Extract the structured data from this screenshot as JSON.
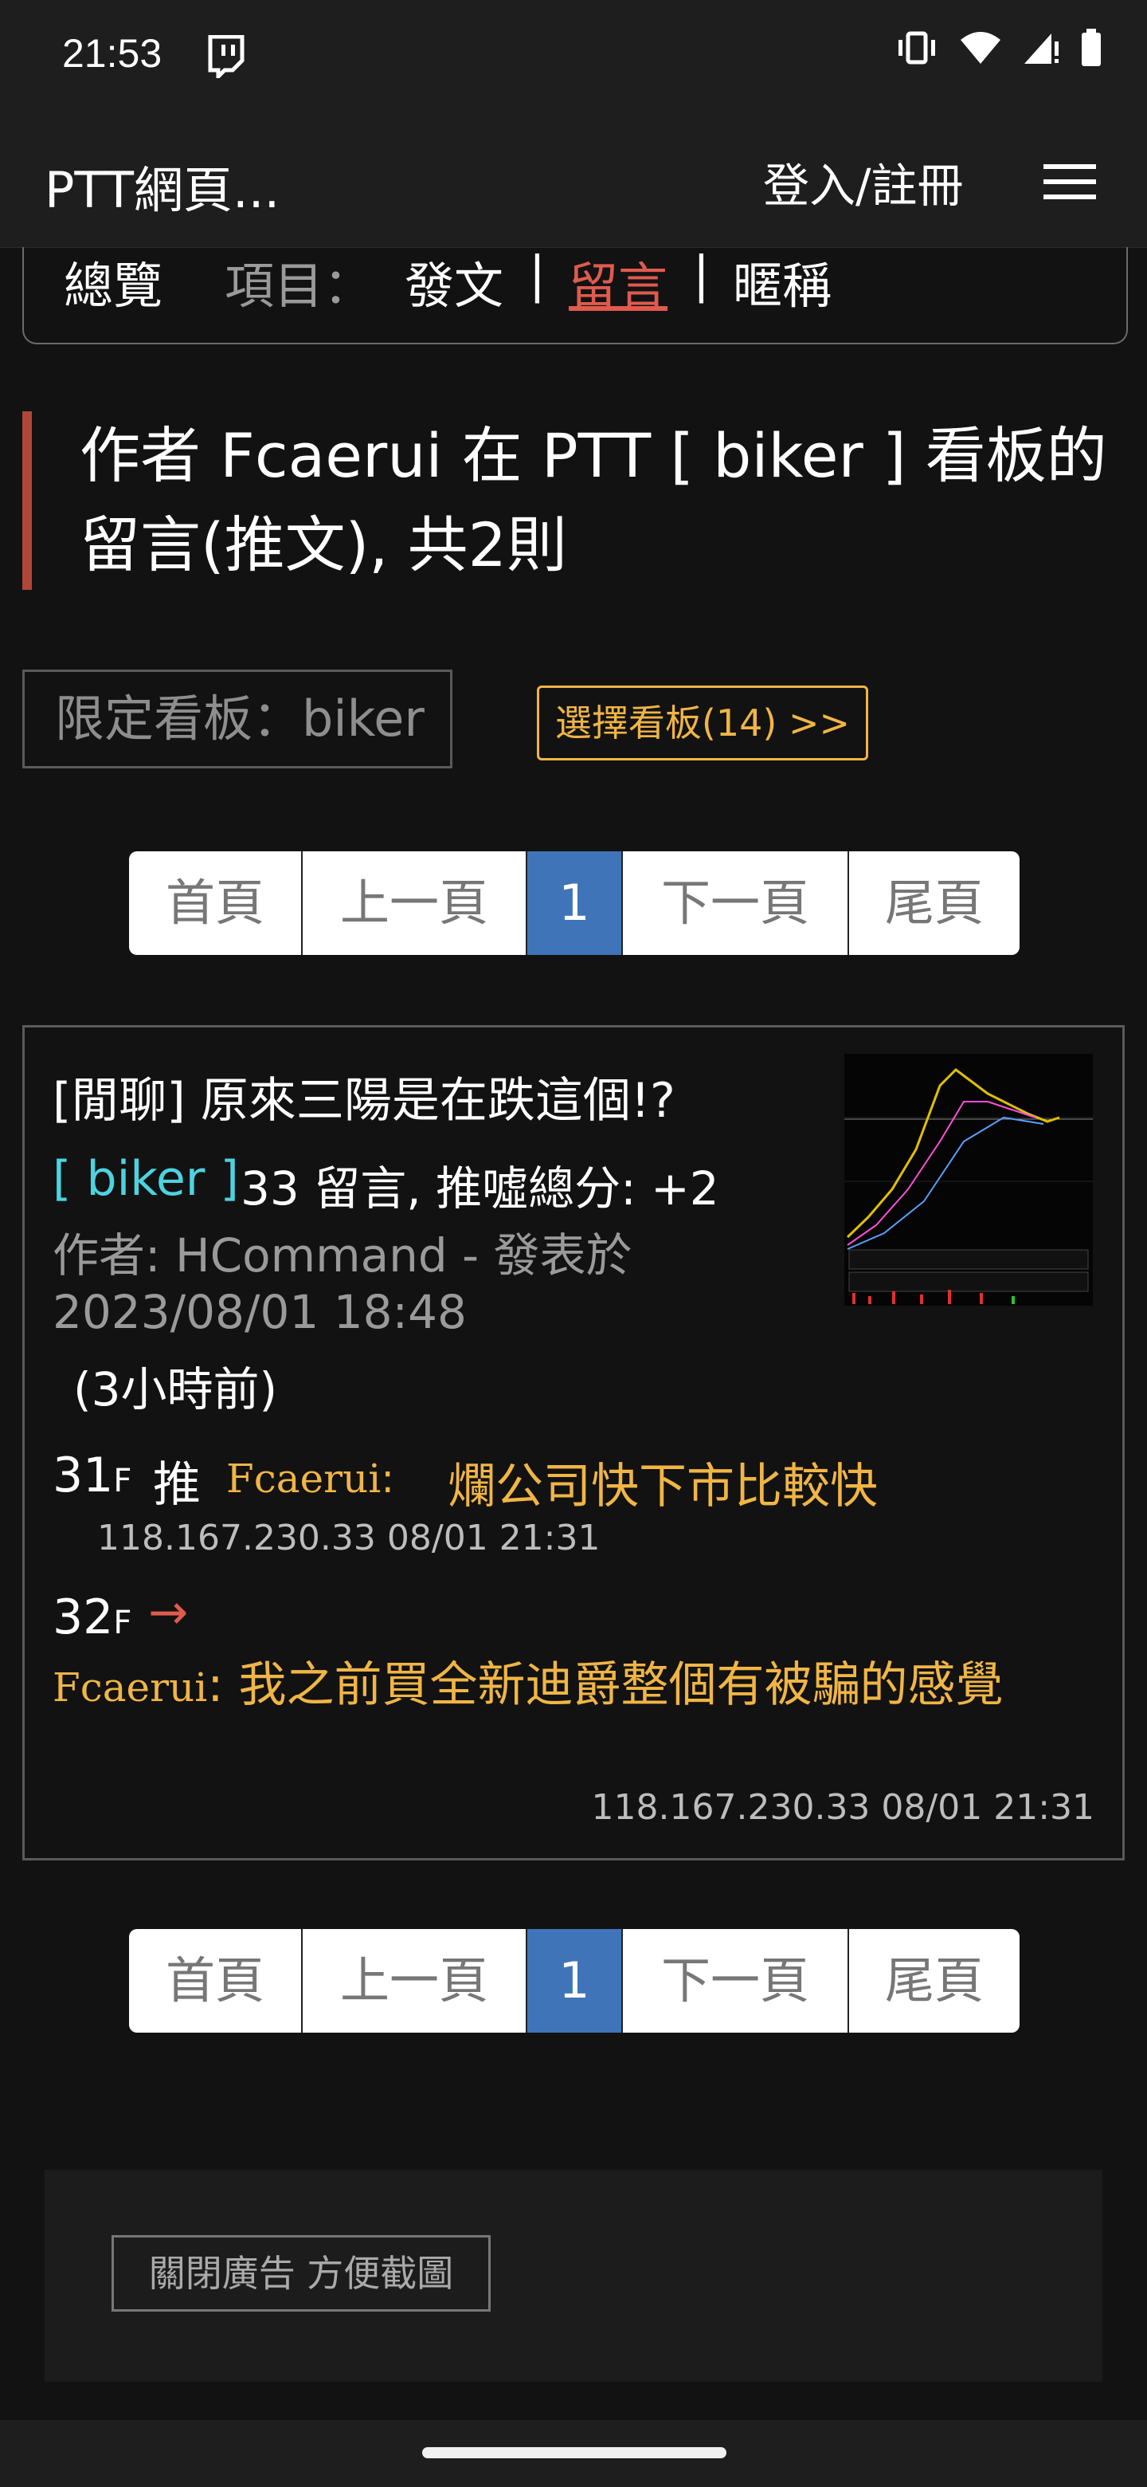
{
  "status": {
    "time": "21:53",
    "icons": [
      "twitch-icon",
      "vibrate-icon",
      "wifi-icon",
      "signal-icon",
      "battery-icon"
    ]
  },
  "appbar": {
    "title": "PTT網頁...",
    "login": "登入/註冊",
    "menu_icon": "hamburger-menu-icon"
  },
  "subnav": {
    "overview": "總覽",
    "items_label": "項目：",
    "posts": "發文",
    "sep1": "|",
    "comments": "留言",
    "sep2": "|",
    "nickname": "暱稱"
  },
  "heading": "作者 Fcaerui 在 PTT [ biker ] 看板的留言(推文), 共2則",
  "filter": {
    "board_label": "限定看板：biker",
    "choose_board": "選擇看板(14) >>"
  },
  "pagination": {
    "first": "首頁",
    "prev": "上一頁",
    "current": "1",
    "next": "下一頁",
    "last": "尾頁"
  },
  "post": {
    "title": "[閒聊] 原來三陽是在跌這個!?",
    "board": "[ biker ]",
    "stats": "33 留言, 推噓總分: +2",
    "author_line": "作者: HCommand - 發表於",
    "date": "2023/08/01 18:48",
    "relative_time": "(3小時前)",
    "comments": [
      {
        "floor": "31",
        "floor_suffix": "F",
        "tag": "推",
        "user": "Fcaerui",
        "colon": ":",
        "text": "爛公司快下市比較快",
        "meta": "118.167.230.33 08/01 21:31"
      },
      {
        "floor": "32",
        "floor_suffix": "F",
        "tag": "→",
        "user": "Fcaerui",
        "colon": ":",
        "text": "我之前買全新迪爵整個有被騙的感覺",
        "meta": "118.167.230.33 08/01 21:31"
      }
    ]
  },
  "ad": {
    "close_button": "關閉廣告 方便截圖"
  },
  "colors": {
    "accent_red": "#e05a4e",
    "board_cyan": "#4dd3e0",
    "comment_gold": "#f0b545",
    "pager_active": "#3f74b8"
  }
}
